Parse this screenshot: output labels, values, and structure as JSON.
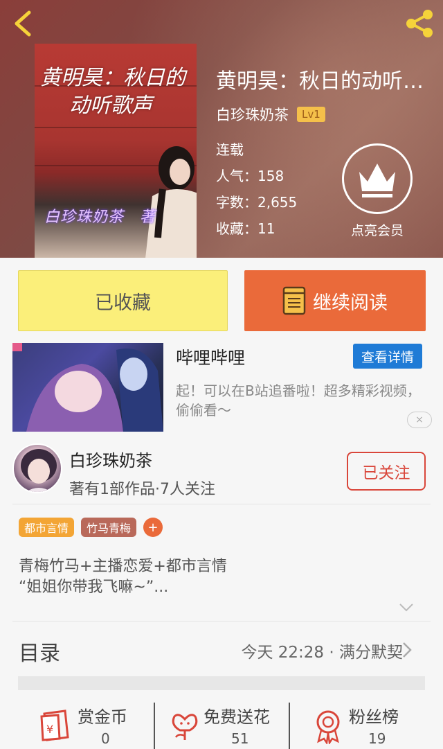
{
  "book": {
    "title": "黄明昊：秋日的动听…",
    "author": "白珍珠奶茶",
    "level": "Lv1",
    "status": "连载",
    "popularity": "人气：158",
    "word_count": "字数：2,655",
    "favorites": "收藏：11",
    "vip_label": "点亮会员",
    "cover_text_line1": "黄明昊：秋日的",
    "cover_text_line2": "动听歌声",
    "cover_signature": "白珍珠奶茶　著"
  },
  "actions": {
    "collected": "已收藏",
    "continue_reading": "继续阅读"
  },
  "ad": {
    "title": "哔哩哔哩",
    "detail_button": "查看详情",
    "description": "起！可以在B站追番啦！超多精彩视频，偷偷看～",
    "close": "×"
  },
  "author_card": {
    "name": "白珍珠奶茶",
    "info": "著有1部作品·7人关注",
    "follow_button": "已关注"
  },
  "tags": [
    {
      "label": "都市言情",
      "color": "#f3a535"
    },
    {
      "label": "竹马青梅",
      "color": "#b9695a"
    }
  ],
  "tag_add": "+",
  "synopsis": {
    "line1": "青梅竹马+主播恋爱+都市言情",
    "line2": "“姐姐你带我飞嘛~”..."
  },
  "catalog": {
    "label": "目录",
    "latest": "今天 22:28 · 满分默契"
  },
  "bottom_stats": [
    {
      "label": "赏金币",
      "value": "0",
      "icon": "red-envelope-icon"
    },
    {
      "label": "免费送花",
      "value": "51",
      "icon": "flower-icon"
    },
    {
      "label": "粉丝榜",
      "value": "19",
      "icon": "medal-icon"
    }
  ],
  "colors": {
    "accent_orange": "#ea6a3a",
    "collected_yellow": "#fbef7a",
    "follow_red": "#d9463a",
    "ad_blue": "#1f7bd6",
    "level_yellow": "#f5c04a"
  }
}
